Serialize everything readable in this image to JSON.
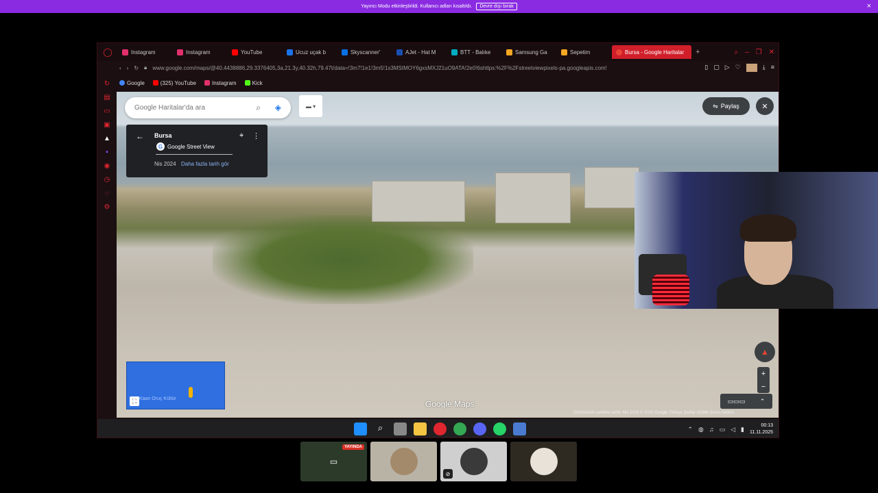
{
  "banner": {
    "message": "Yayıncı Modu etkinleştirildi. Kullanıcı adları kısaltıldı.",
    "button": "Devre dışı bırak",
    "close": "×"
  },
  "tabs": [
    {
      "label": "Instagram",
      "color": "#e1306c"
    },
    {
      "label": "Instagram",
      "color": "#e1306c"
    },
    {
      "label": "YouTube",
      "color": "#ff0000"
    },
    {
      "label": "Ucuz uçak b",
      "color": "#1a73e8"
    },
    {
      "label": "Skyscanner'",
      "color": "#0770e3"
    },
    {
      "label": "AJet - Hat M",
      "color": "#1a4fb0"
    },
    {
      "label": "BTT - Balıke",
      "color": "#00acc1"
    },
    {
      "label": "Samsung Ga",
      "color": "#f5a623"
    },
    {
      "label": "Sepetim",
      "color": "#f5a623"
    }
  ],
  "active_tab": {
    "label": "Bursa - Google Haritalar",
    "color": "#ea4335"
  },
  "address": {
    "url": "www.google.com/maps/@40.4438886,29.3376405,3a,21.3y,40.32h,79.47t/data=!3m7!1e1!3m5!1s3MStMOY6gxsMXJ21uO9ATA!2e0!6shttps:%2F%2Fstreetviewpixels-pa.googleapis.com!"
  },
  "bookmarks": [
    {
      "label": "Google",
      "color": "#4285f4"
    },
    {
      "label": "(325) YouTube",
      "color": "#ff0000"
    },
    {
      "label": "Instagram",
      "color": "#e1306c"
    },
    {
      "label": "Kick",
      "color": "#53fc18"
    }
  ],
  "maps": {
    "search_placeholder": "Google Haritalar'da ara",
    "share": "Paylaş",
    "place": "Bursa",
    "source": "Google Street View",
    "date": "Nis 2024",
    "more_dates": "Daha fazla tarih gör",
    "watermark": "Google Maps",
    "footer": "Görüntünün çekilme tarihi: Nis 2024   © 2025 Google   Türkiye   Şartlar   Gizlilik   Sorun bildirin",
    "minimap_label": "Kaan Oruç Kültür"
  },
  "taskbar": {
    "time": "00:13",
    "date": "11.11.2025"
  },
  "participants": {
    "live_badge": "YAYINDA"
  }
}
